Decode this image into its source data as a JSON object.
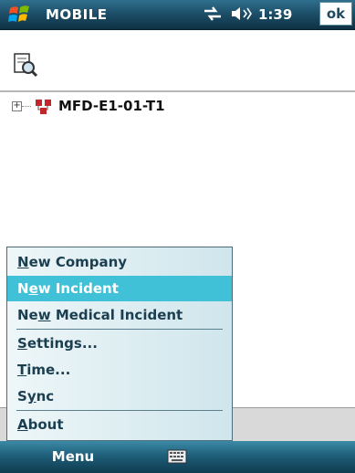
{
  "titlebar": {
    "app_title": "MOBILE",
    "time": "1:39",
    "ok_label": "ok",
    "icons": [
      "windows-logo",
      "connectivity",
      "volume"
    ]
  },
  "toolbar": {
    "icons": [
      "find-icon"
    ]
  },
  "tree": {
    "nodes": [
      {
        "label": "MFD-E1-01-T1",
        "expander": "+",
        "icon": "unit-icon"
      }
    ]
  },
  "menu": {
    "items": [
      {
        "label": "New Company",
        "mnemonic": "N",
        "selected": false
      },
      {
        "label": "New Incident",
        "mnemonic": "e",
        "selected": true
      },
      {
        "label": "New Medical Incident",
        "mnemonic": "w",
        "selected": false
      },
      {
        "label": "Settings...",
        "mnemonic": "S",
        "selected": false
      },
      {
        "label": "Time...",
        "mnemonic": "T",
        "selected": false
      },
      {
        "label": "Sync",
        "mnemonic": "y",
        "selected": false
      },
      {
        "label": "About",
        "mnemonic": "A",
        "selected": false
      }
    ]
  },
  "softkeys": {
    "left": "Menu",
    "icons": [
      "keyboard-icon"
    ]
  },
  "colors": {
    "titlebar": "#1d4f69",
    "selection": "#41c1d7",
    "menu_text": "#1b3f50"
  }
}
